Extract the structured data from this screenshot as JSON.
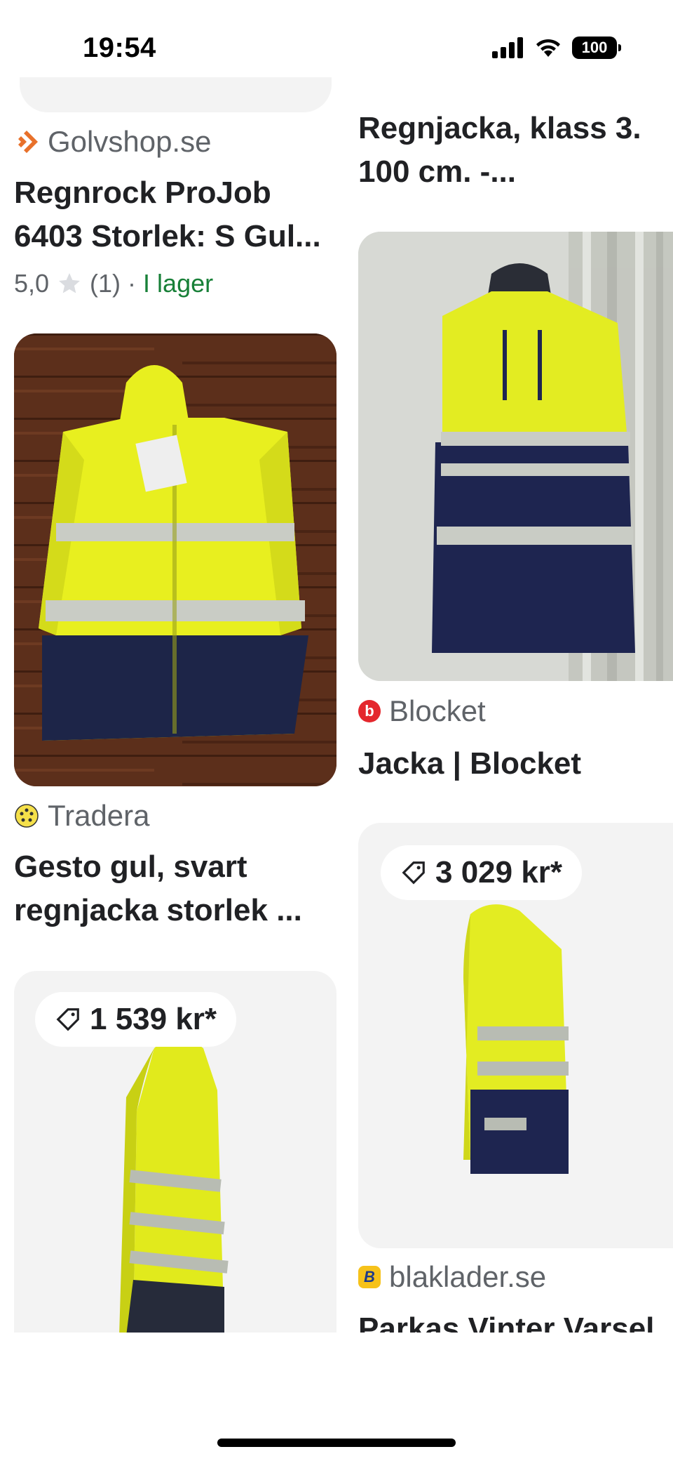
{
  "status_bar": {
    "time": "19:54",
    "battery": "100"
  },
  "results": [
    {
      "source": "Golvshop.se",
      "title_line1": "Regnrock ProJob",
      "title_line2": "6403 Storlek: S Gul...",
      "rating": "5,0",
      "reviews": "(1)",
      "separator": "·",
      "availability": "I lager"
    },
    {
      "title_line1": "Regnjacka, klass 3.",
      "title_line2": "100 cm. -..."
    },
    {
      "source": "Tradera",
      "title_line1": "Gesto gul, svart",
      "title_line2": "regnjacka storlek ..."
    },
    {
      "source": "Blocket",
      "title_line1": "Jacka | Blocket"
    },
    {
      "price": "1 539 kr*"
    },
    {
      "price": "3 029 kr*",
      "source": "blaklader.se",
      "title_line1": "Parkas Vinter Varsel"
    }
  ],
  "colors": {
    "hi_vis_yellow": "#e8ef1f",
    "navy": "#1d2548",
    "reflective": "#c9ccc5",
    "wood": "#5a2e1a",
    "stock_green": "#188038"
  }
}
